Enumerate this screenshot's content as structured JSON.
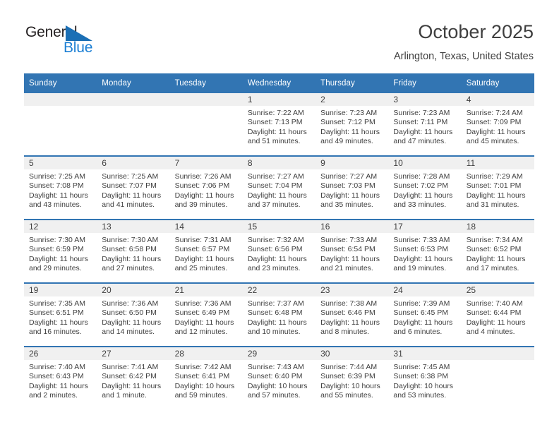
{
  "logo": {
    "word_one": "General",
    "word_two": "Blue",
    "triangle_color": "#1b6fb5",
    "blue_text_color": "#1b7fd4"
  },
  "header": {
    "title": "October 2025",
    "subtitle": "Arlington, Texas, United States"
  },
  "theme": {
    "header_blue": "#3275b3",
    "daynum_band": "#f0f0f0",
    "text": "#3f3f3f"
  },
  "labels": {
    "sunrise": "Sunrise:",
    "sunset": "Sunset:",
    "daylight": "Daylight:"
  },
  "weekdays": [
    "Sunday",
    "Monday",
    "Tuesday",
    "Wednesday",
    "Thursday",
    "Friday",
    "Saturday"
  ],
  "weeks": [
    [
      {
        "day": "",
        "sunrise": "",
        "sunset": "",
        "daylight": "",
        "empty": true
      },
      {
        "day": "",
        "sunrise": "",
        "sunset": "",
        "daylight": "",
        "empty": true
      },
      {
        "day": "",
        "sunrise": "",
        "sunset": "",
        "daylight": "",
        "empty": true
      },
      {
        "day": "1",
        "sunrise": "Sunrise: 7:22 AM",
        "sunset": "Sunset: 7:13 PM",
        "daylight": "Daylight: 11 hours and 51 minutes."
      },
      {
        "day": "2",
        "sunrise": "Sunrise: 7:23 AM",
        "sunset": "Sunset: 7:12 PM",
        "daylight": "Daylight: 11 hours and 49 minutes."
      },
      {
        "day": "3",
        "sunrise": "Sunrise: 7:23 AM",
        "sunset": "Sunset: 7:11 PM",
        "daylight": "Daylight: 11 hours and 47 minutes."
      },
      {
        "day": "4",
        "sunrise": "Sunrise: 7:24 AM",
        "sunset": "Sunset: 7:09 PM",
        "daylight": "Daylight: 11 hours and 45 minutes."
      }
    ],
    [
      {
        "day": "5",
        "sunrise": "Sunrise: 7:25 AM",
        "sunset": "Sunset: 7:08 PM",
        "daylight": "Daylight: 11 hours and 43 minutes."
      },
      {
        "day": "6",
        "sunrise": "Sunrise: 7:25 AM",
        "sunset": "Sunset: 7:07 PM",
        "daylight": "Daylight: 11 hours and 41 minutes."
      },
      {
        "day": "7",
        "sunrise": "Sunrise: 7:26 AM",
        "sunset": "Sunset: 7:06 PM",
        "daylight": "Daylight: 11 hours and 39 minutes."
      },
      {
        "day": "8",
        "sunrise": "Sunrise: 7:27 AM",
        "sunset": "Sunset: 7:04 PM",
        "daylight": "Daylight: 11 hours and 37 minutes."
      },
      {
        "day": "9",
        "sunrise": "Sunrise: 7:27 AM",
        "sunset": "Sunset: 7:03 PM",
        "daylight": "Daylight: 11 hours and 35 minutes."
      },
      {
        "day": "10",
        "sunrise": "Sunrise: 7:28 AM",
        "sunset": "Sunset: 7:02 PM",
        "daylight": "Daylight: 11 hours and 33 minutes."
      },
      {
        "day": "11",
        "sunrise": "Sunrise: 7:29 AM",
        "sunset": "Sunset: 7:01 PM",
        "daylight": "Daylight: 11 hours and 31 minutes."
      }
    ],
    [
      {
        "day": "12",
        "sunrise": "Sunrise: 7:30 AM",
        "sunset": "Sunset: 6:59 PM",
        "daylight": "Daylight: 11 hours and 29 minutes."
      },
      {
        "day": "13",
        "sunrise": "Sunrise: 7:30 AM",
        "sunset": "Sunset: 6:58 PM",
        "daylight": "Daylight: 11 hours and 27 minutes."
      },
      {
        "day": "14",
        "sunrise": "Sunrise: 7:31 AM",
        "sunset": "Sunset: 6:57 PM",
        "daylight": "Daylight: 11 hours and 25 minutes."
      },
      {
        "day": "15",
        "sunrise": "Sunrise: 7:32 AM",
        "sunset": "Sunset: 6:56 PM",
        "daylight": "Daylight: 11 hours and 23 minutes."
      },
      {
        "day": "16",
        "sunrise": "Sunrise: 7:33 AM",
        "sunset": "Sunset: 6:54 PM",
        "daylight": "Daylight: 11 hours and 21 minutes."
      },
      {
        "day": "17",
        "sunrise": "Sunrise: 7:33 AM",
        "sunset": "Sunset: 6:53 PM",
        "daylight": "Daylight: 11 hours and 19 minutes."
      },
      {
        "day": "18",
        "sunrise": "Sunrise: 7:34 AM",
        "sunset": "Sunset: 6:52 PM",
        "daylight": "Daylight: 11 hours and 17 minutes."
      }
    ],
    [
      {
        "day": "19",
        "sunrise": "Sunrise: 7:35 AM",
        "sunset": "Sunset: 6:51 PM",
        "daylight": "Daylight: 11 hours and 16 minutes."
      },
      {
        "day": "20",
        "sunrise": "Sunrise: 7:36 AM",
        "sunset": "Sunset: 6:50 PM",
        "daylight": "Daylight: 11 hours and 14 minutes."
      },
      {
        "day": "21",
        "sunrise": "Sunrise: 7:36 AM",
        "sunset": "Sunset: 6:49 PM",
        "daylight": "Daylight: 11 hours and 12 minutes."
      },
      {
        "day": "22",
        "sunrise": "Sunrise: 7:37 AM",
        "sunset": "Sunset: 6:48 PM",
        "daylight": "Daylight: 11 hours and 10 minutes."
      },
      {
        "day": "23",
        "sunrise": "Sunrise: 7:38 AM",
        "sunset": "Sunset: 6:46 PM",
        "daylight": "Daylight: 11 hours and 8 minutes."
      },
      {
        "day": "24",
        "sunrise": "Sunrise: 7:39 AM",
        "sunset": "Sunset: 6:45 PM",
        "daylight": "Daylight: 11 hours and 6 minutes."
      },
      {
        "day": "25",
        "sunrise": "Sunrise: 7:40 AM",
        "sunset": "Sunset: 6:44 PM",
        "daylight": "Daylight: 11 hours and 4 minutes."
      }
    ],
    [
      {
        "day": "26",
        "sunrise": "Sunrise: 7:40 AM",
        "sunset": "Sunset: 6:43 PM",
        "daylight": "Daylight: 11 hours and 2 minutes."
      },
      {
        "day": "27",
        "sunrise": "Sunrise: 7:41 AM",
        "sunset": "Sunset: 6:42 PM",
        "daylight": "Daylight: 11 hours and 1 minute."
      },
      {
        "day": "28",
        "sunrise": "Sunrise: 7:42 AM",
        "sunset": "Sunset: 6:41 PM",
        "daylight": "Daylight: 10 hours and 59 minutes."
      },
      {
        "day": "29",
        "sunrise": "Sunrise: 7:43 AM",
        "sunset": "Sunset: 6:40 PM",
        "daylight": "Daylight: 10 hours and 57 minutes."
      },
      {
        "day": "30",
        "sunrise": "Sunrise: 7:44 AM",
        "sunset": "Sunset: 6:39 PM",
        "daylight": "Daylight: 10 hours and 55 minutes."
      },
      {
        "day": "31",
        "sunrise": "Sunrise: 7:45 AM",
        "sunset": "Sunset: 6:38 PM",
        "daylight": "Daylight: 10 hours and 53 minutes."
      },
      {
        "day": "",
        "sunrise": "",
        "sunset": "",
        "daylight": "",
        "empty": true
      }
    ]
  ]
}
